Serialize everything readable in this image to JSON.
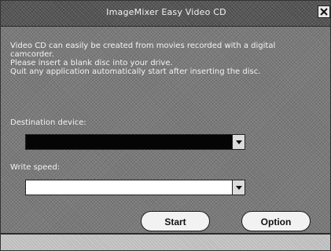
{
  "window": {
    "title": "ImageMixer Easy Video CD",
    "close_icon": "close-icon"
  },
  "content": {
    "message_lines": [
      "Video CD can easily be created from movies recorded with a digital",
      "camcorder.",
      "Please insert a blank disc into your drive.",
      "Quit any application automatically start after inserting the disc."
    ],
    "destination_label": "Destination device:",
    "destination_value": "",
    "write_speed_label": "Write speed:",
    "write_speed_value": ""
  },
  "buttons": {
    "start_label": "Start",
    "option_label": "Option"
  }
}
